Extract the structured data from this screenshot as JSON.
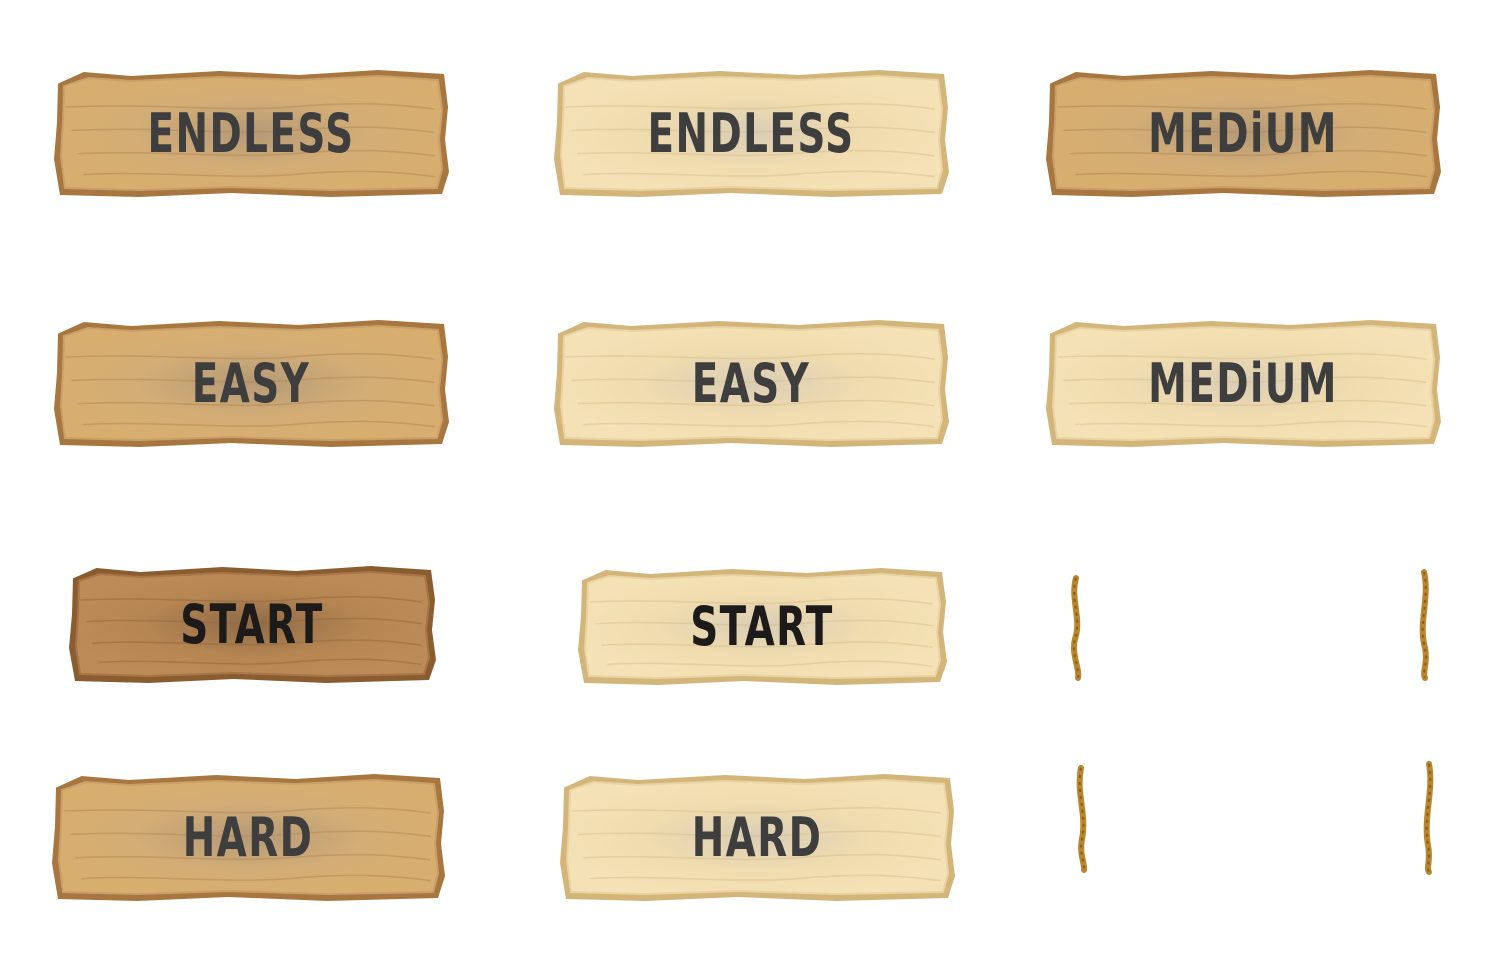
{
  "colors": {
    "text": "#3e3e3e",
    "text_dark": "#1d1b19",
    "wood_normal": "#d2a86e",
    "wood_light": "#f1ddb0",
    "wood_dark": "#b3824f",
    "rope": "#b8862e"
  },
  "buttons": {
    "endless_normal": {
      "label": "ENDLESS"
    },
    "endless_hover": {
      "label": "ENDLESS"
    },
    "medium_normal": {
      "label": "MEDiUM"
    },
    "easy_normal": {
      "label": "EASY"
    },
    "easy_hover": {
      "label": "EASY"
    },
    "medium_hover": {
      "label": "MEDiUM"
    },
    "start_pressed": {
      "label": "START"
    },
    "start_hover": {
      "label": "START"
    },
    "hard_normal": {
      "label": "HARD"
    },
    "hard_hover": {
      "label": "HARD"
    }
  },
  "ropes": [
    {
      "name": "rope-left-1"
    },
    {
      "name": "rope-right-1"
    },
    {
      "name": "rope-left-2"
    },
    {
      "name": "rope-right-2"
    }
  ]
}
